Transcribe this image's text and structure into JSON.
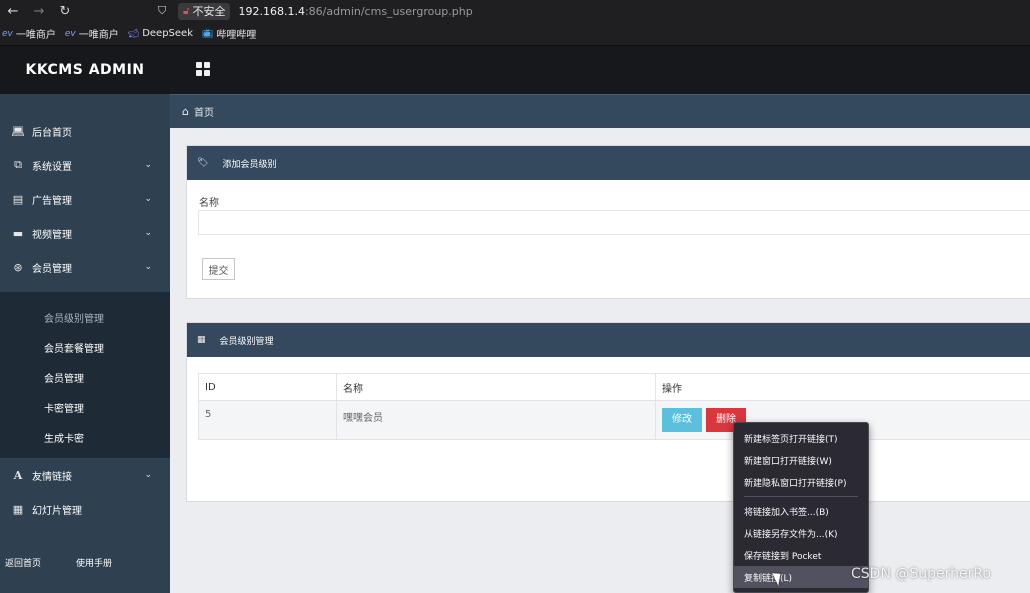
{
  "browser": {
    "insecure_label": "不安全",
    "url_host": "192.168.1.4",
    "url_rest": ":86/admin/cms_usergroup.php",
    "bookmarks": [
      {
        "icon": "e",
        "label": "一唯商户"
      },
      {
        "icon": "e",
        "label": "一唯商户"
      },
      {
        "icon": "deepseek",
        "label": "DeepSeek"
      },
      {
        "icon": "bilibili",
        "label": "哔哩哔哩"
      }
    ]
  },
  "brand": "KKCMS ADMIN",
  "sidebar": {
    "items": [
      {
        "label": "后台首页",
        "icon": "laptop-icon"
      },
      {
        "label": "系统设置",
        "icon": "settings-icon"
      },
      {
        "label": "广告管理",
        "icon": "list-icon"
      },
      {
        "label": "视频管理",
        "icon": "video-icon"
      },
      {
        "label": "会员管理",
        "icon": "lifebuoy-icon"
      }
    ],
    "submenu": [
      {
        "label": "会员级别管理"
      },
      {
        "label": "会员套餐管理"
      },
      {
        "label": "会员管理"
      },
      {
        "label": "卡密管理"
      },
      {
        "label": "生成卡密"
      }
    ],
    "items_after": [
      {
        "label": "友情链接",
        "icon": "font-icon"
      },
      {
        "label": "幻灯片管理",
        "icon": "table-icon"
      }
    ],
    "footer": {
      "home": "返回首页",
      "manual": "使用手册"
    }
  },
  "breadcrumb": {
    "home": "首页"
  },
  "add_panel": {
    "title": "添加会员级别",
    "name_label": "名称",
    "name_value": "",
    "submit": "提交"
  },
  "list_panel": {
    "title": "会员级别管理",
    "columns": [
      "ID",
      "名称",
      "操作"
    ],
    "rows": [
      {
        "id": "5",
        "name": "嘿嘿会员",
        "edit": "修改",
        "delete": "删除"
      }
    ]
  },
  "context_menu": {
    "group1": [
      "新建标签页打开链接(T)",
      "新建窗口打开链接(W)",
      "新建隐私窗口打开链接(P)"
    ],
    "group2": [
      "将链接加入书签...(B)",
      "从链接另存文件为...(K)",
      "保存链接到 Pocket",
      "复制链接(L)"
    ]
  },
  "watermark": "CSDN @SuperherRo"
}
